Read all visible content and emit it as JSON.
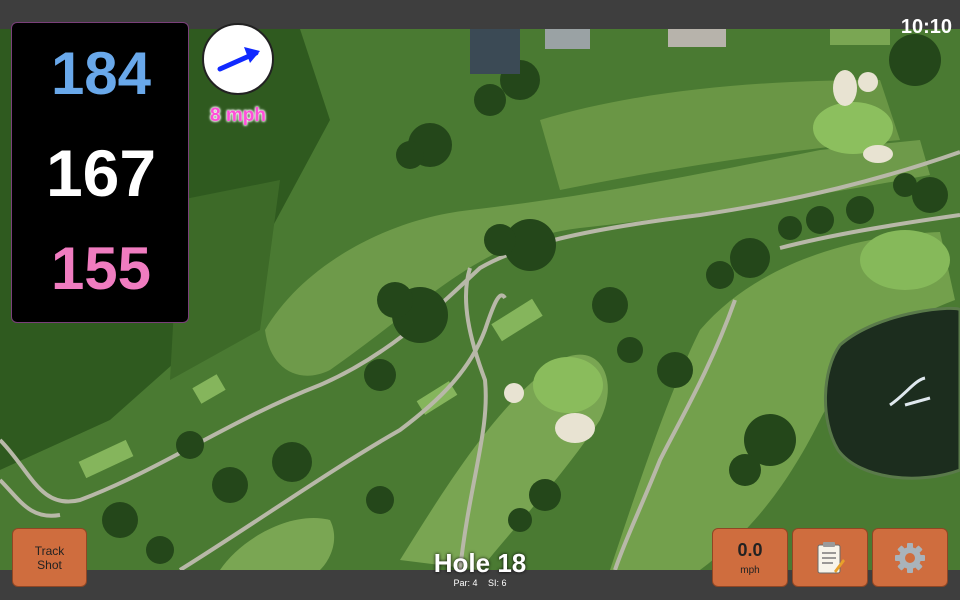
{
  "status_bar": {
    "time": "10:10"
  },
  "distances": {
    "back": "184",
    "center": "167",
    "front": "155"
  },
  "wind": {
    "direction_icon": "arrow-icon",
    "speed_label": "8 mph"
  },
  "hole": {
    "title": "Hole 18",
    "par": "Par: 4",
    "si": "SI: 6"
  },
  "buttons": {
    "track_shot": "Track Shot",
    "wind_value": "0.0",
    "wind_unit": "mph",
    "notes_icon": "notepad-icon",
    "settings_icon": "gear-icon"
  },
  "colors": {
    "back_distance": "#69a8ea",
    "center_distance": "#ffffff",
    "front_distance": "#f07cc0",
    "wind_text": "#ff4fd8",
    "button": "#cf6d3e",
    "wind_arrow": "#1029ff"
  }
}
